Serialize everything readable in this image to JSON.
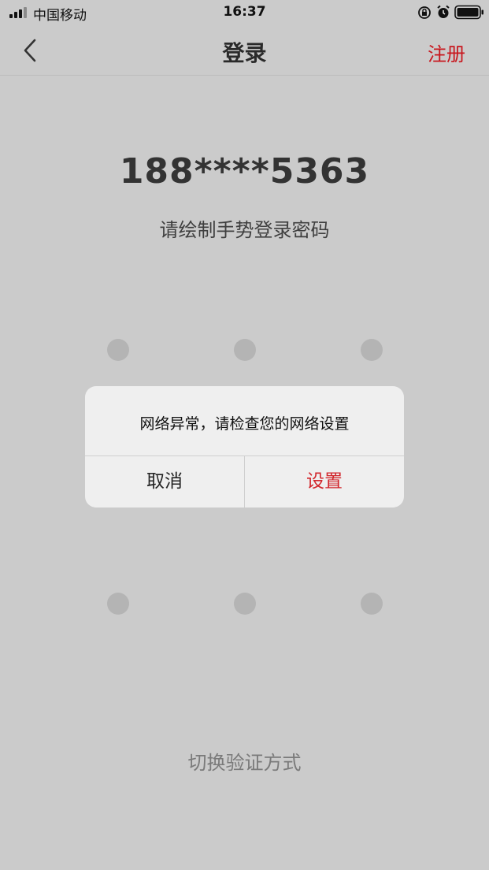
{
  "status_bar": {
    "carrier": "中国移动",
    "time": "16:37",
    "icons": [
      "signal-icon",
      "orientation-lock-icon",
      "alarm-icon",
      "battery-icon"
    ]
  },
  "nav": {
    "title": "登录",
    "register_label": "注册",
    "back_icon": "chevron-left-icon"
  },
  "account": {
    "phone_masked": "188****5363",
    "hint": "请绘制手势登录密码"
  },
  "gesture_grid": {
    "rows": 3,
    "cols": 3
  },
  "footer": {
    "switch_label": "切换验证方式"
  },
  "dialog": {
    "message": "网络异常，请检查您的网络设置",
    "cancel_label": "取消",
    "confirm_label": "设置"
  },
  "colors": {
    "accent": "#c8171e",
    "background": "#cbcbcb",
    "dialog_bg": "#efefef"
  }
}
